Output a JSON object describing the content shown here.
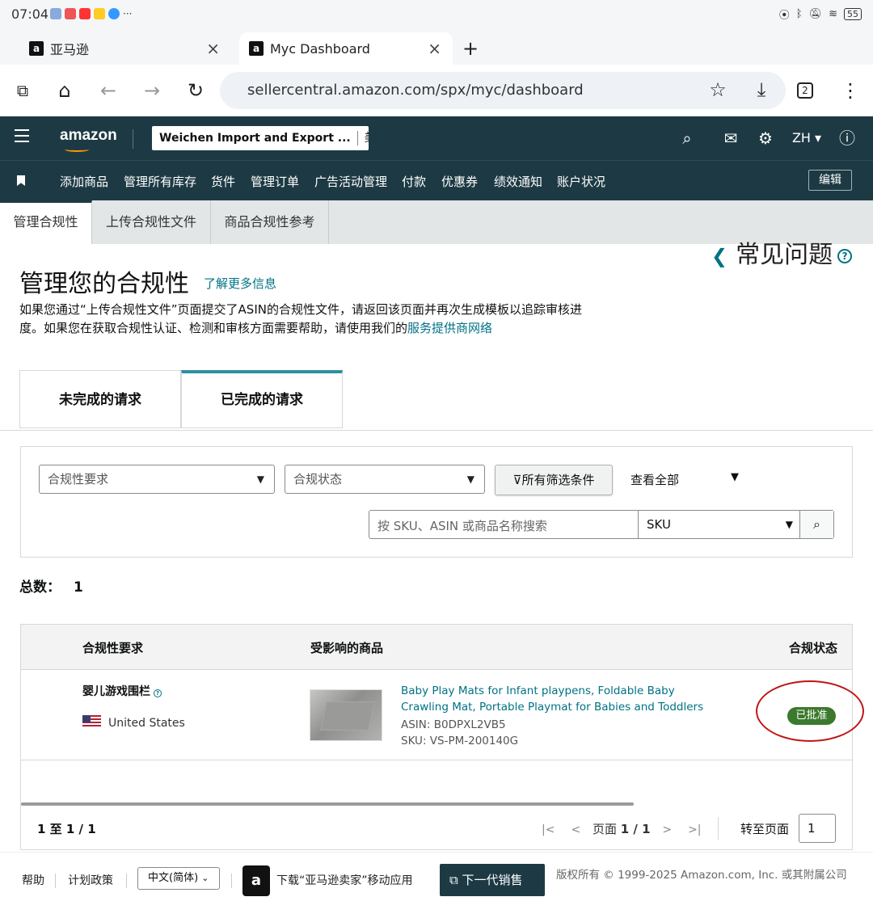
{
  "statusbar": {
    "time": "07:04",
    "battery": "55"
  },
  "browser": {
    "tabs": [
      {
        "label": "亚马逊"
      },
      {
        "label": "Myc Dashboard"
      }
    ],
    "new_tab": "+",
    "url": "sellercentral.amazon.com/spx/myc/dashboard",
    "tab_count": "2"
  },
  "header": {
    "logo": "amazon",
    "store_name": "Weichen Import and Export ...",
    "marketplace": "美.",
    "lang": "ZH"
  },
  "nav": {
    "items": [
      "添加商品",
      "管理所有库存",
      "货件",
      "管理订单",
      "广告活动管理",
      "付款",
      "优惠券",
      "绩效通知",
      "账户状况"
    ],
    "edit_label": "编辑"
  },
  "page_tabs": [
    "管理合规性",
    "上传合规性文件",
    "商品合规性参考"
  ],
  "faq_label": "常见问题",
  "page": {
    "title": "管理您的合规性",
    "learn_more": "了解更多信息",
    "desc_1": "如果您通过“上传合规性文件”页面提交了ASIN的合规性文件，请返回该页面并再次生成模板以追踪审核进度。如果您在获取合规性认证、检测和审核方面需要帮助，请使用我们的",
    "desc_link": "服务提供商网络"
  },
  "request_tabs": [
    "未完成的请求",
    "已完成的请求"
  ],
  "filters": {
    "requirement_placeholder": "合规性要求",
    "status_placeholder": "合规状态",
    "all_filters": "所有筛选条件",
    "view_all": "查看全部",
    "search_placeholder": "按 SKU、ASIN 或商品名称搜索",
    "search_type": "SKU"
  },
  "total": {
    "label": "总数：",
    "value": "1"
  },
  "table": {
    "headers": [
      "合规性要求",
      "受影响的商品",
      "合规状态"
    ],
    "rows": [
      {
        "requirement": "婴儿游戏围栏",
        "country": "United States",
        "product_title": "Baby Play Mats for Infant playpens, Foldable Baby Crawling Mat, Portable Playmat for Babies and Toddlers",
        "asin": "ASIN: B0DPXL2VB5",
        "sku": "SKU: VS-PM-200140G",
        "status": "已批准"
      }
    ]
  },
  "pager": {
    "range": "1 至 1 / 1",
    "page_label": "页面",
    "page_value": "1 / 1",
    "goto_label": "转至页面",
    "goto_value": "1"
  },
  "footer": {
    "help": "帮助",
    "policy": "计划政策",
    "language": "中文(简体)",
    "app_download": "下载“亚马逊卖家”移动应用",
    "next_gen": "下一代销售",
    "copyright": "版权所有 © 1999-2025 Amazon.com, Inc. 或其附属公司"
  },
  "colors": {
    "header_bg": "#1d3a44",
    "link": "#007185",
    "approved": "#3b7a2e",
    "annotation": "#c21515"
  }
}
